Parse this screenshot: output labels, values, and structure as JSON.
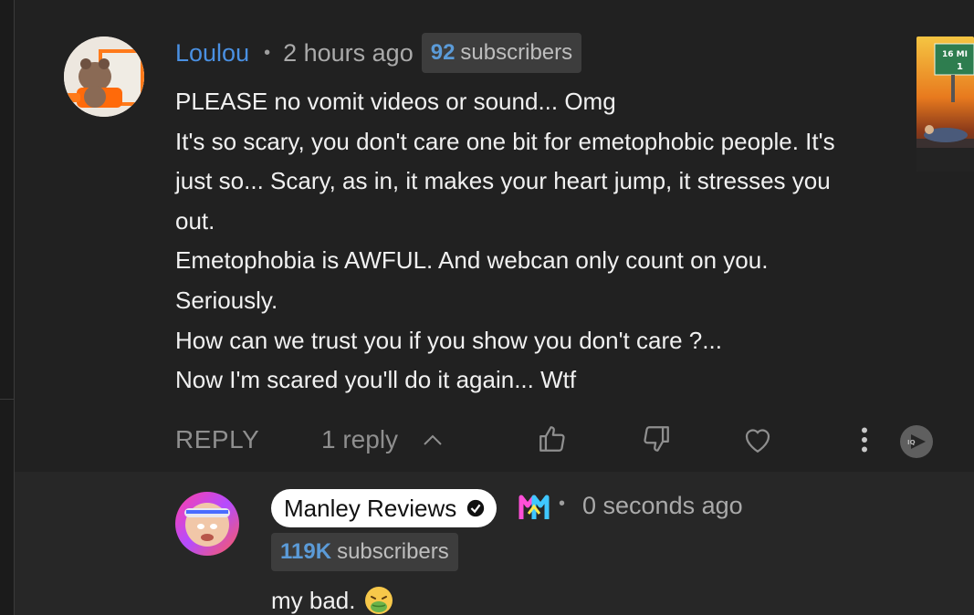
{
  "comment": {
    "author": "Loulou",
    "separator": "•",
    "time": "2 hours ago",
    "subscriber_count": "92",
    "subscriber_label": "subscribers",
    "lines": [
      "PLEASE no vomit videos or sound... Omg",
      "It's so scary, you don't care one bit for emetophobic people. It's",
      "just so... Scary, as in, it makes your heart jump, it stresses you",
      "out.",
      "Emetophobia is AWFUL. And webcan only count on you.",
      "Seriously.",
      "How can we trust you if you show you don't care ?...",
      "Now I'm scared you'll do it again... Wtf"
    ],
    "thumbnail_text": "16 MI 1",
    "actions": {
      "reply_label": "REPLY",
      "replies_label": "1 reply",
      "icons": [
        "chevron-up-icon",
        "thumbs-up-icon",
        "thumbs-down-icon",
        "heart-icon",
        "more-vert-icon",
        "tubebuddy-icon"
      ]
    }
  },
  "reply": {
    "author": "Manley Reviews",
    "separator": "•",
    "time": "0 seconds ago",
    "subscriber_count": "119K",
    "subscriber_label": "subscribers",
    "text": "my bad.",
    "emoji": "nauseated-face-emoji",
    "badges": [
      "verified-check-icon",
      "member-badge-icon"
    ]
  },
  "colors": {
    "background": "#212121",
    "reply_background": "#272727",
    "author_link": "#4a90e2",
    "subscriber_number": "#5b9bd8",
    "muted_text": "#aaaaaa"
  }
}
